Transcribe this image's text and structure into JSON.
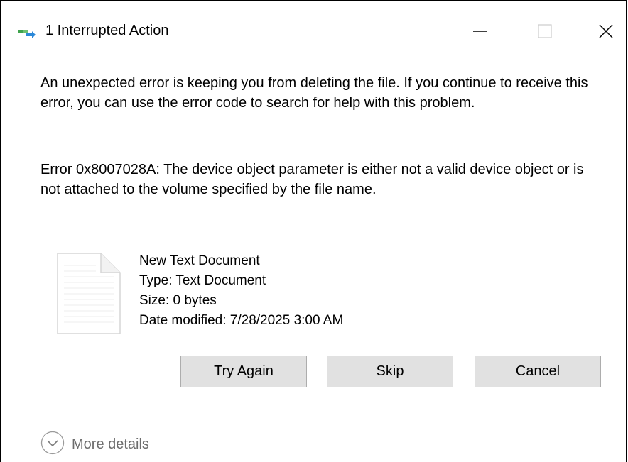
{
  "window": {
    "title": "1 Interrupted Action",
    "controls": {
      "minimize_icon": "minimize-icon",
      "maximize_icon": "maximize-icon",
      "close_icon": "close-icon"
    }
  },
  "dialog": {
    "message": "An unexpected error is keeping you from deleting the file. If you continue to receive this error, you can use the error code to search for help with this problem.",
    "error": "Error 0x8007028A: The device object parameter is either not a valid device object or is not attached to the volume specified by the file name."
  },
  "file": {
    "icon": "text-document-icon",
    "name": "New Text Document",
    "type": "Type: Text Document",
    "size": "Size: 0 bytes",
    "date_modified": "Date modified: 7/28/2025 3:00 AM"
  },
  "buttons": {
    "try_again": "Try Again",
    "skip": "Skip",
    "cancel": "Cancel"
  },
  "footer": {
    "more_details": "More details",
    "icon": "chevron-down-circle-icon"
  },
  "colors": {
    "button_face": "#e1e1e1",
    "button_border": "#adadad",
    "muted_text": "#6d6d6d",
    "accent_green": "#3fa34d",
    "accent_blue": "#2b88d8"
  }
}
